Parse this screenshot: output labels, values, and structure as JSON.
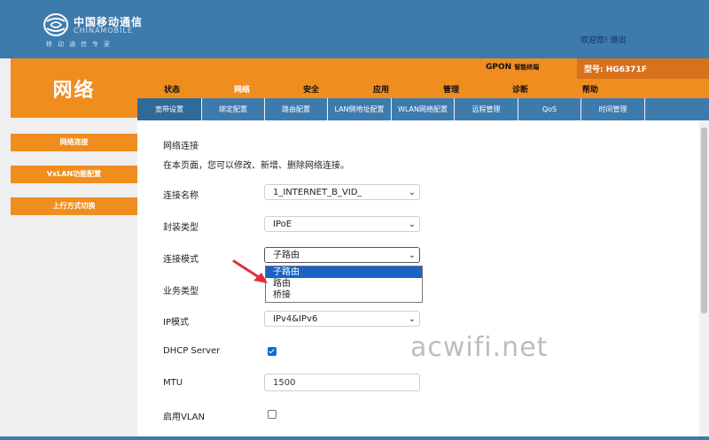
{
  "brand": {
    "name_cn": "中国移动通信",
    "name_en": "CHINAMOBILE",
    "slogan": "移动通信专家"
  },
  "header": {
    "welcome": "欢迎您!",
    "logout": "退出"
  },
  "section_title": "网络",
  "device": {
    "type_main": "GPON",
    "type_sub": "智能终端",
    "model": "型号: HG6371F"
  },
  "menu": [
    "状态",
    "网络",
    "安全",
    "应用",
    "管理",
    "诊断",
    "帮助"
  ],
  "submenu": [
    "宽带设置",
    "绑定配置",
    "路由配置",
    "LAN侧地址配置",
    "WLAN网络配置",
    "远程管理",
    "QoS",
    "时间管理"
  ],
  "sidebar": [
    "网络连接",
    "VxLAN功能配置",
    "上行方式切换"
  ],
  "content": {
    "title": "网络连接",
    "desc": "在本页面，您可以修改、新增、删除网络连接。",
    "fields": {
      "connection_name": {
        "label": "连接名称",
        "value": "1_INTERNET_B_VID_"
      },
      "encapsulation": {
        "label": "封装类型",
        "value": "IPoE"
      },
      "connection_mode": {
        "label": "连接模式",
        "value": "子路由"
      },
      "service_type": {
        "label": "业务类型"
      },
      "ip_mode": {
        "label": "IP模式",
        "value": "IPv4&IPv6"
      },
      "dhcp_server": {
        "label": "DHCP Server",
        "checked": true
      },
      "mtu": {
        "label": "MTU",
        "value": "1500"
      },
      "vlan": {
        "label": "启用VLAN",
        "checked": false
      }
    },
    "dropdown_options": [
      "子路由",
      "路由",
      "桥接"
    ]
  },
  "watermark": "acwifi.net",
  "colors": {
    "header_blue": "#3e7bad",
    "orange": "#f08d1f",
    "selected_option": "#1a62c6",
    "arrow_red": "#e0303a"
  }
}
